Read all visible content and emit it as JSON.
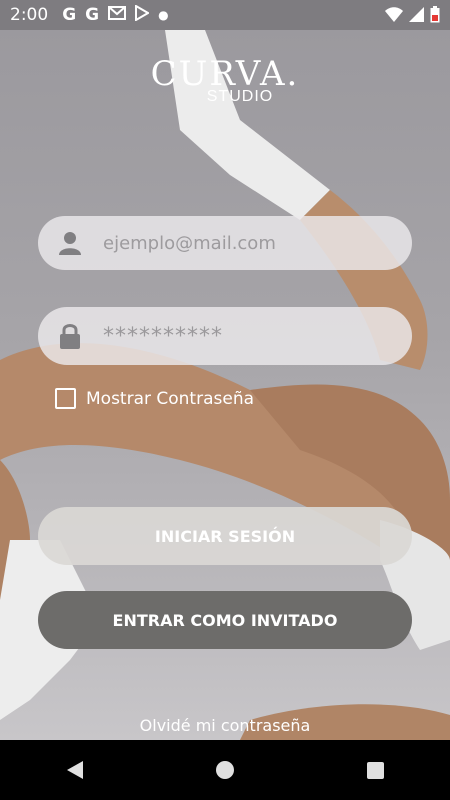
{
  "status_bar": {
    "time": "2:00",
    "left_icons": [
      "google-icon",
      "google-icon",
      "gmail-icon",
      "play-store-icon",
      "dot-icon"
    ],
    "right_icons": [
      "wifi-icon",
      "cell-signal-icon",
      "battery-icon"
    ]
  },
  "logo": {
    "main": "CURVA.",
    "sub": "STUDIO"
  },
  "form": {
    "email_placeholder": "ejemplo@mail.com",
    "password_value": "**********",
    "show_password_label": "Mostrar Contraseña",
    "show_password_checked": false
  },
  "buttons": {
    "login": "INICIAR SESIÓN",
    "guest": "ENTRAR COMO INVITADO"
  },
  "forgot_password": "Olvidé mi contraseña",
  "nav": {
    "icons": [
      "back-icon",
      "home-icon",
      "recents-icon"
    ]
  }
}
